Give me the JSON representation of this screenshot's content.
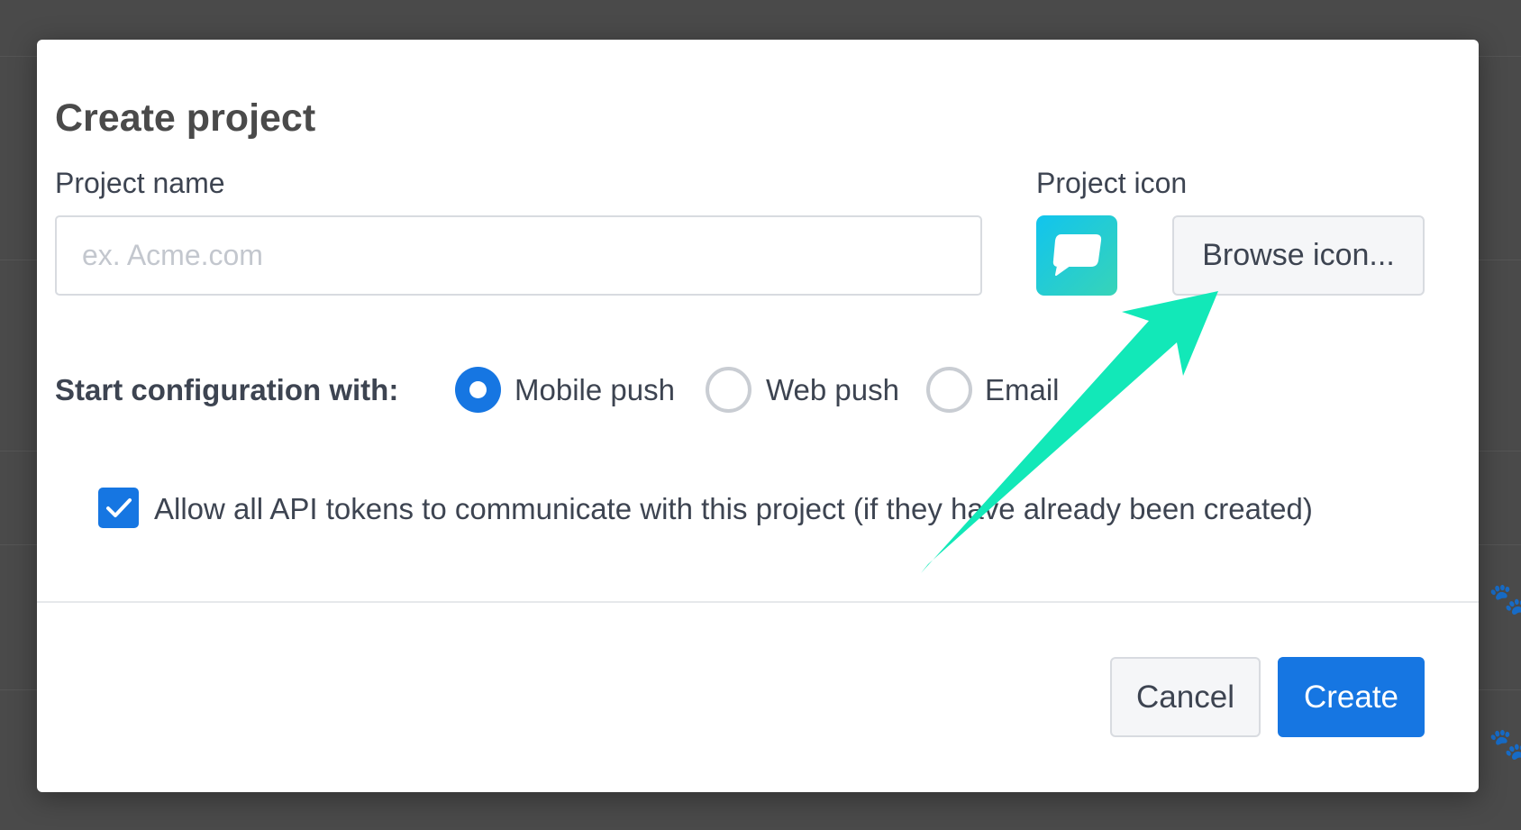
{
  "modal": {
    "title": "Create project",
    "project_name": {
      "label": "Project name",
      "placeholder": "ex. Acme.com",
      "value": ""
    },
    "project_icon": {
      "label": "Project icon",
      "icon": "chat-bubble-icon",
      "browse_label": "Browse icon..."
    },
    "configuration": {
      "label": "Start configuration with:",
      "options": [
        {
          "label": "Mobile push",
          "selected": true
        },
        {
          "label": "Web push",
          "selected": false
        },
        {
          "label": "Email",
          "selected": false
        }
      ]
    },
    "api_tokens": {
      "checked": true,
      "label": "Allow all API tokens to communicate with this project (if they have already been created)"
    },
    "footer": {
      "cancel_label": "Cancel",
      "create_label": "Create"
    }
  },
  "colors": {
    "primary": "#1676e2",
    "annotation_arrow": "#12e8b8",
    "icon_gradient_start": "#11c4ee",
    "icon_gradient_end": "#37d4b8",
    "overlay": "#4a4a4a"
  }
}
